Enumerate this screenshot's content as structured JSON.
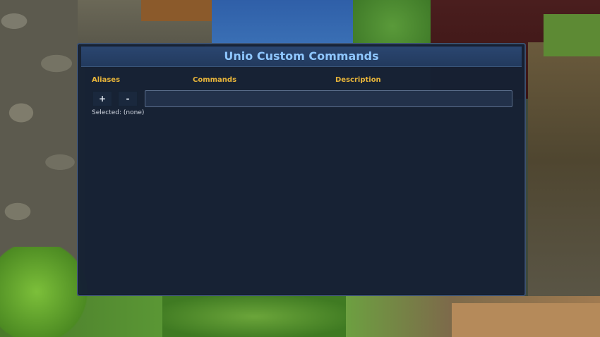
{
  "window": {
    "title": "Unio Custom Commands"
  },
  "columns": {
    "aliases": "Aliases",
    "commands": "Commands",
    "description": "Description"
  },
  "controls": {
    "add_label": "+",
    "remove_label": "-",
    "command_input_value": "",
    "selected_text": "Selected: (none)"
  },
  "colors": {
    "title": "#8fc7ff",
    "column_header": "#e8b53a",
    "panel_bg": "#162134"
  }
}
